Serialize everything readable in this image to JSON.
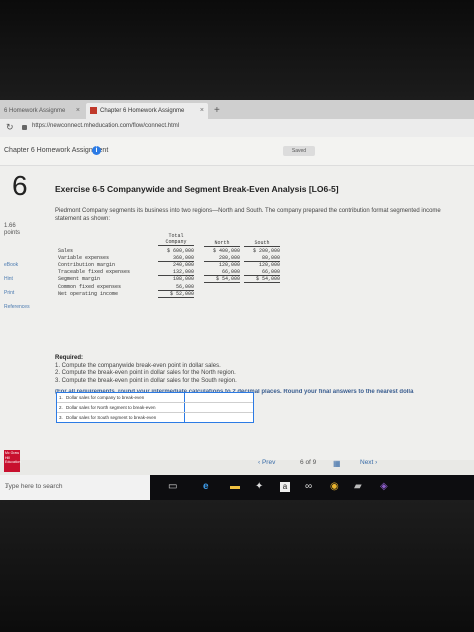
{
  "browser": {
    "tabs": [
      {
        "label": "6 Homework Assignme"
      },
      {
        "label": "Chapter 6 Homework Assignme"
      }
    ],
    "tab_close": "×",
    "new_tab": "+",
    "url": "https://newconnect.mheducation.com/flow/connect.html"
  },
  "app": {
    "assignment_title": "Chapter 6 Homework Assignment",
    "saved_label": "Saved"
  },
  "question": {
    "number": "6",
    "points_value": "1.66",
    "points_label": "points",
    "side_links": [
      "eBook",
      "Hint",
      "Print",
      "References"
    ],
    "title": "Exercise 6-5 Companywide and Segment Break-Even Analysis [LO6-5]",
    "intro": "Piedmont Company segments its business into two regions—North and South. The company prepared the contribution format segmented income statement as shown:",
    "statement": {
      "headers": [
        "Total\nCompany",
        "North",
        "South"
      ],
      "rows": [
        {
          "label": "Sales",
          "values": [
            "$ 600,000",
            "$ 400,000",
            "$ 200,000"
          ]
        },
        {
          "label": "Variable expenses",
          "values": [
            "360,000",
            "280,000",
            "80,000"
          ]
        },
        {
          "label": "Contribution margin",
          "values": [
            "240,000",
            "120,000",
            "120,000"
          ]
        },
        {
          "label": "Traceable fixed expenses",
          "values": [
            "132,000",
            "66,000",
            "66,000"
          ]
        },
        {
          "label": "Segment margin",
          "values": [
            "108,000",
            "$ 54,000",
            "$ 54,000"
          ]
        },
        {
          "label": "Common fixed expenses",
          "values": [
            "56,000",
            "",
            ""
          ]
        },
        {
          "label": "Net operating income",
          "values": [
            "$ 52,000",
            "",
            ""
          ]
        }
      ]
    },
    "required_heading": "Required:",
    "requirements": [
      "1. Compute the companywide break-even point in dollar sales.",
      "2. Compute the break-even point in dollar sales for the North region.",
      "3. Compute the break-even point in dollar sales for the South region."
    ],
    "rounding_note": "(For all requirements, round your intermediate calculations to 2 decimal places. Round your final answers to the nearest dolla",
    "answers": [
      {
        "num": "1.",
        "label": "Dollar sales for company to break-even",
        "value": ""
      },
      {
        "num": "2.",
        "label": "Dollar sales for North segment to break-even",
        "value": ""
      },
      {
        "num": "3.",
        "label": "Dollar sales for South segment to break-even",
        "value": ""
      }
    ]
  },
  "footer": {
    "logo_text": "Mc Graw Hill Education",
    "prev_label": "‹ Prev",
    "page_current": "6",
    "page_of": "of",
    "page_total": "9",
    "next_label": "Next ›"
  },
  "taskbar": {
    "search_placeholder": "Type here to search"
  }
}
